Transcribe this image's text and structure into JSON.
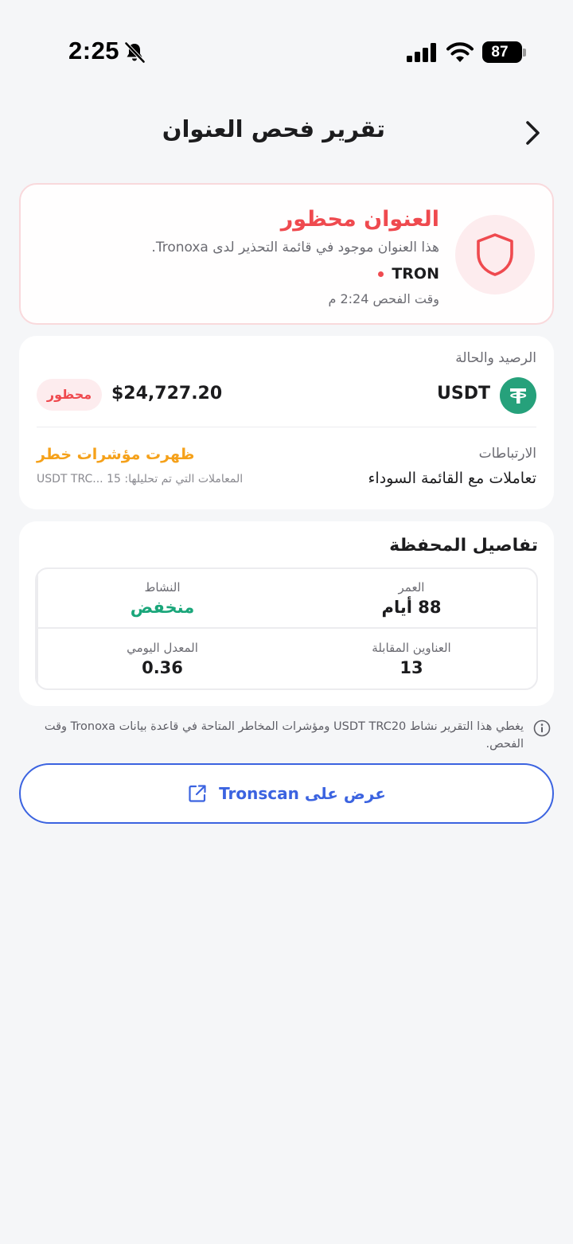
{
  "status_bar": {
    "time": "2:25",
    "battery": "87"
  },
  "header": {
    "title": "تقرير فحص العنوان"
  },
  "alert": {
    "title": "العنوان محظور",
    "description": "هذا العنوان موجود في قائمة التحذير لدى Tronoxa.",
    "network": "TRON",
    "scan_time": "وقت الفحص 2:24 م"
  },
  "balance": {
    "section_label": "الرصيد والحالة",
    "token": "USDT",
    "amount": "$24,727.20",
    "status": "محظور",
    "links_label": "الارتباطات",
    "links_value": "تعاملات مع القائمة السوداء",
    "risk_label": "ظهرت مؤشرات خطر",
    "analyzed_label": "المعاملات التي تم تحليلها: 15",
    "analyzed_tokens": "USDT TRC..."
  },
  "wallet": {
    "title": "تفاصيل المحفظة",
    "stats": [
      {
        "label": "العمر",
        "value": "88 أيام"
      },
      {
        "label": "النشاط",
        "value": "منخفض"
      },
      {
        "label": "العناوين المقابلة",
        "value": "13"
      },
      {
        "label": "المعدل اليومي",
        "value": "0.36"
      }
    ]
  },
  "footnote": "يغطي هذا التقرير نشاط USDT TRC20 ومؤشرات المخاطر المتاحة في قاعدة بيانات Tronoxa وقت الفحص.",
  "tronscan_button": "عرض على Tronscan",
  "colors": {
    "danger": "#ef4a4f",
    "warning": "#f5a11a",
    "success": "#1aa67a",
    "primary": "#3b63e0",
    "tether": "#26a17b"
  },
  "icons": {
    "bell": "bell-slash-icon",
    "signal": "cellular-signal-icon",
    "wifi": "wifi-icon",
    "back": "chevron-right-icon",
    "shield": "shield-icon",
    "token": "tether-icon",
    "info": "info-icon",
    "external": "external-link-icon"
  }
}
